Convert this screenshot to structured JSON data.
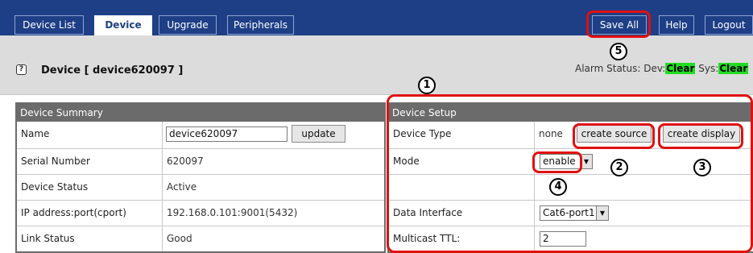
{
  "nav": {
    "tabs": [
      {
        "label": "Device List"
      },
      {
        "label": "Device"
      },
      {
        "label": "Upgrade"
      },
      {
        "label": "Peripherals"
      }
    ],
    "right_tabs": [
      {
        "label": "Save All"
      },
      {
        "label": "Help"
      },
      {
        "label": "Logout"
      }
    ]
  },
  "header": {
    "help_icon": "?",
    "title": "Device [ device620097 ]",
    "alarm_prefix": "Alarm Status: Dev:",
    "alarm_dev": "Clear",
    "alarm_sys_prefix": " Sys:",
    "alarm_sys": "Clear"
  },
  "summary": {
    "heading": "Device Summary",
    "name_label": "Name",
    "name_value": "device620097",
    "update_label": "update",
    "serial_label": "Serial Number",
    "serial_value": "620097",
    "status_label": "Device Status",
    "status_value": "Active",
    "ip_label": "IP address:port(cport)",
    "ip_value": "192.168.0.101:9001(5432)",
    "link_label": "Link Status",
    "link_value": "Good"
  },
  "setup": {
    "heading": "Device Setup",
    "type_label": "Device Type",
    "type_value": "none",
    "create_source_label": "create source",
    "create_display_label": "create display",
    "mode_label": "Mode",
    "mode_value": "enable",
    "interface_label": "Data Interface",
    "interface_value": "Cat6-port1",
    "ttl_label": "Multicast TTL:",
    "ttl_value": "2"
  },
  "annotations": [
    "1",
    "2",
    "3",
    "4",
    "5"
  ],
  "colors": {
    "nav_bg": "#1e3f86",
    "panel_header": "#6b6b6b",
    "alarm_clear": "#22dd22",
    "annotation_red": "#e01010"
  }
}
